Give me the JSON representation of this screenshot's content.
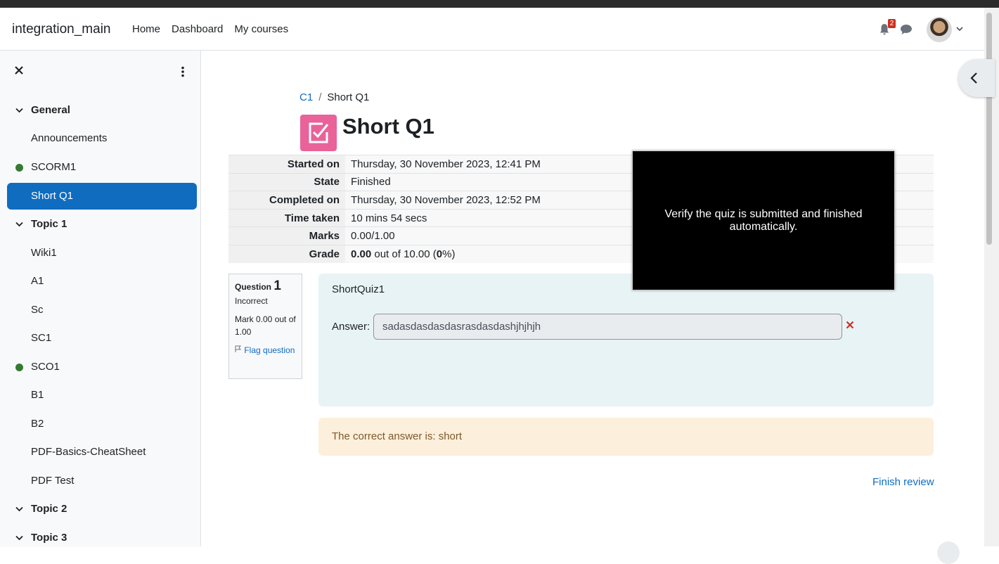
{
  "navbar": {
    "brand": "integration_main",
    "links": [
      "Home",
      "Dashboard",
      "My courses"
    ],
    "notification_count": "2"
  },
  "drawer": {
    "items": [
      {
        "type": "section",
        "label": "General"
      },
      {
        "type": "item",
        "label": "Announcements"
      },
      {
        "type": "item-dot",
        "label": "SCORM1"
      },
      {
        "type": "active",
        "label": "Short Q1"
      },
      {
        "type": "section",
        "label": "Topic 1"
      },
      {
        "type": "item",
        "label": "Wiki1"
      },
      {
        "type": "item",
        "label": "A1"
      },
      {
        "type": "item",
        "label": "Sc"
      },
      {
        "type": "item",
        "label": "SC1"
      },
      {
        "type": "item-dot",
        "label": "SCO1"
      },
      {
        "type": "item",
        "label": "B1"
      },
      {
        "type": "item",
        "label": "B2"
      },
      {
        "type": "item",
        "label": "PDF-Basics-CheatSheet"
      },
      {
        "type": "item",
        "label": "PDF Test"
      },
      {
        "type": "section",
        "label": "Topic 2"
      },
      {
        "type": "section",
        "label": "Topic 3"
      }
    ]
  },
  "breadcrumb": {
    "course": "C1",
    "separator": "/",
    "current": "Short Q1"
  },
  "page_title": "Short Q1",
  "summary": [
    {
      "label": "Started on",
      "value": "Thursday, 30 November 2023, 12:41 PM"
    },
    {
      "label": "State",
      "value": "Finished"
    },
    {
      "label": "Completed on",
      "value": "Thursday, 30 November 2023, 12:52 PM"
    },
    {
      "label": "Time taken",
      "value": "10 mins 54 secs"
    },
    {
      "label": "Marks",
      "value": "0.00/1.00"
    }
  ],
  "grade": {
    "label": "Grade",
    "score": "0.00",
    "middle": " out of 10.00 (",
    "percent": "0",
    "end": "%)"
  },
  "question": {
    "label": "Question",
    "number": "1",
    "state": "Incorrect",
    "mark": "Mark 0.00 out of 1.00",
    "flag": "Flag question",
    "text": "ShortQuiz1",
    "answer_label": "Answer:",
    "answer_value": "sadasdasdasdasrasdasdashjhjhjh",
    "feedback": "The correct answer is: short"
  },
  "finish_review": "Finish review",
  "overlay_text": "Verify the quiz is submitted and finished automatically.",
  "colors": {
    "primary": "#0f6cbf",
    "quiz_icon": "#e9629a",
    "success_dot": "#357a32",
    "wrong": "#ca3120"
  }
}
